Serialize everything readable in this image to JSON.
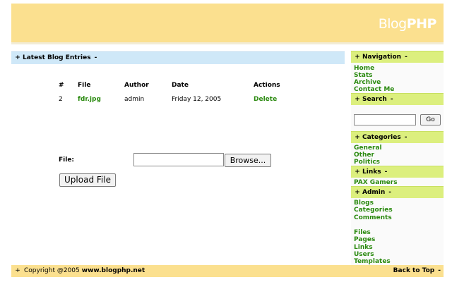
{
  "header": {
    "logo_light": "Blog",
    "logo_bold": "PHP"
  },
  "main": {
    "section_title": "Latest Blog Entries",
    "plus": "+",
    "minus": "-",
    "columns": [
      "#",
      "File",
      "Author",
      "Date",
      "Actions"
    ],
    "rows": [
      {
        "num": "2",
        "file": "fdr.jpg",
        "author": "admin",
        "date": "Friday 12, 2005",
        "action": "Delete"
      }
    ],
    "file_label": "File:",
    "browse_label": "Browse...",
    "upload_label": "Upload File"
  },
  "sidebar": {
    "navigation": {
      "title": "Navigation",
      "items": [
        "Home",
        "Stats",
        "Archive",
        "Contact Me"
      ]
    },
    "search": {
      "title": "Search",
      "go_label": "Go"
    },
    "categories": {
      "title": "Categories",
      "items": [
        "General",
        "Other",
        "Politics"
      ]
    },
    "links": {
      "title": "Links",
      "items": [
        "PAX Gamers"
      ]
    },
    "admin": {
      "title": "Admin",
      "items": [
        "Blogs",
        "Categories",
        "Comments",
        "Files",
        "Pages",
        "Links",
        "Users",
        "Templates"
      ]
    }
  },
  "footer": {
    "copyright": "Copyright @2005",
    "site": "www.blogphp.net",
    "back_to_top": "Back to Top"
  },
  "colors": {
    "header_bg": "#fbe08f",
    "main_bar_bg": "#cfe8f8",
    "sidebar_head_bg": "#dcef7e",
    "link_green": "#2b8a10"
  }
}
